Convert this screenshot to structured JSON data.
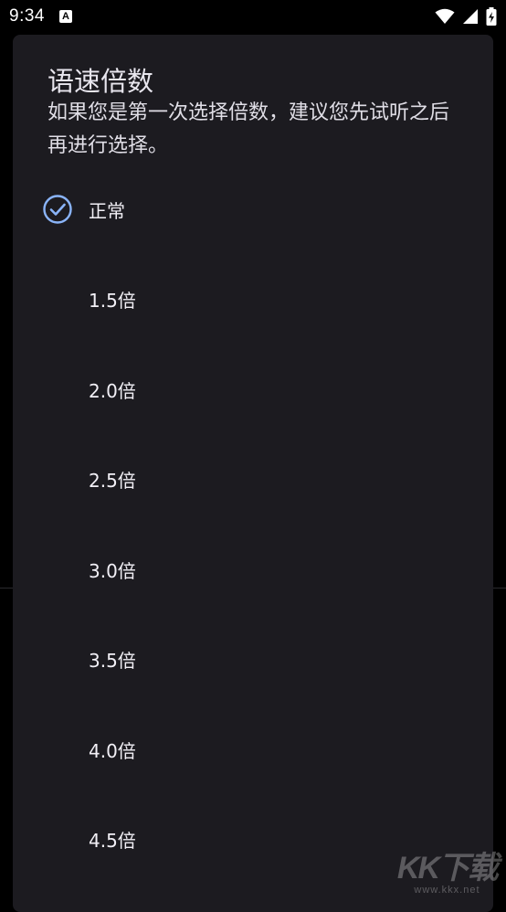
{
  "status_bar": {
    "time": "9:34",
    "notification_glyph": "A"
  },
  "dialog": {
    "title": "语速倍数",
    "message": "如果您是第一次选择倍数，建议您先试听之后再进行选择。",
    "options": [
      {
        "label": "正常",
        "selected": true
      },
      {
        "label": "1.5倍",
        "selected": false
      },
      {
        "label": "2.0倍",
        "selected": false
      },
      {
        "label": "2.5倍",
        "selected": false
      },
      {
        "label": "3.0倍",
        "selected": false
      },
      {
        "label": "3.5倍",
        "selected": false
      },
      {
        "label": "4.0倍",
        "selected": false
      },
      {
        "label": "4.5倍",
        "selected": false
      }
    ]
  },
  "watermark": {
    "logo": "KK下载",
    "url": "www.kkx.net"
  },
  "colors": {
    "background": "#000000",
    "dialog_surface": "#1c1b20",
    "accent_check": "#8ab4f8",
    "text_primary": "#f2f0f6"
  },
  "icons": {
    "selected_indicator": "check-circle-icon",
    "wifi": "wifi-icon",
    "signal": "signal-icon",
    "battery": "battery-charging-icon"
  }
}
